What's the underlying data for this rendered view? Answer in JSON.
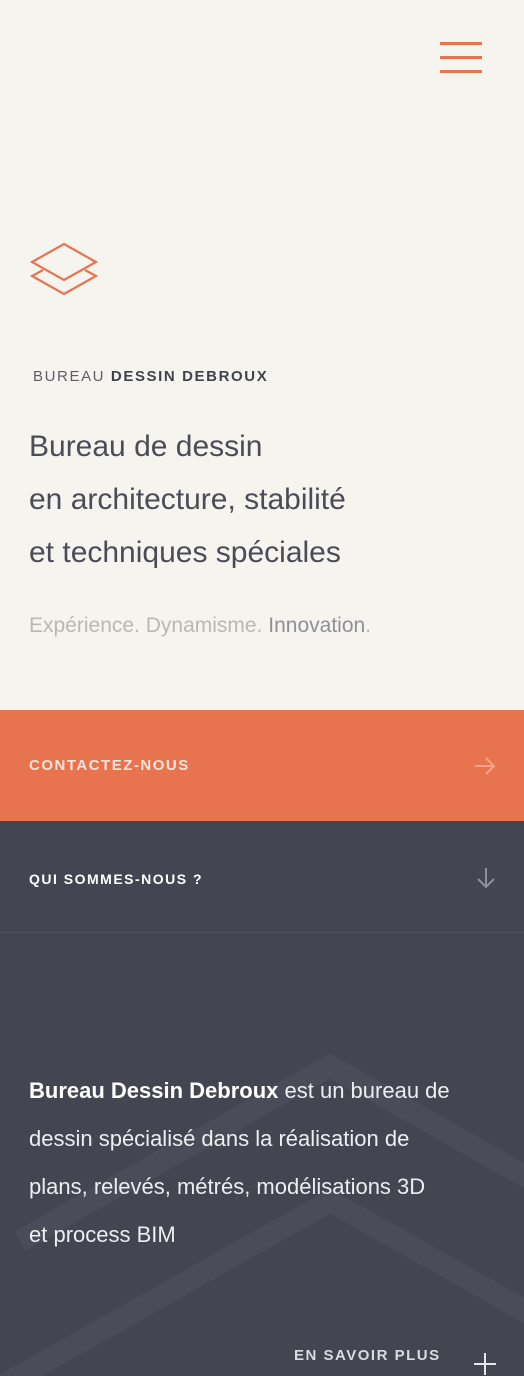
{
  "header": {
    "menu_icon": "hamburger-menu-icon"
  },
  "brand": {
    "logo_icon": "layers-icon",
    "prefix": "BUREAU",
    "name": "DESSIN DEBROUX"
  },
  "hero": {
    "tagline": [
      "Bureau de dessin",
      "en architecture, stabilité",
      "et techniques spéciales"
    ],
    "values": {
      "part1": "Expérience. Dynamisme. ",
      "part2": "Innovation",
      "part3": "."
    }
  },
  "contact": {
    "label": "CONTACTEZ-NOUS",
    "icon": "arrow-right-icon"
  },
  "about": {
    "toggle_label": "QUI SOMMES-NOUS ?",
    "toggle_icon": "arrow-down-icon",
    "company": "Bureau Dessin Debroux",
    "line1_rest": " est un bureau de",
    "line2": "dessin spécialisé dans la réalisation de",
    "line3": "plans, relevés, métrés, modélisations 3D",
    "line4": "et process BIM",
    "more_label": "EN SAVOIR PLUS",
    "more_icon": "plus-icon"
  },
  "colors": {
    "accent": "#e8734f",
    "background": "#f6f4ef",
    "dark": "#434650"
  }
}
